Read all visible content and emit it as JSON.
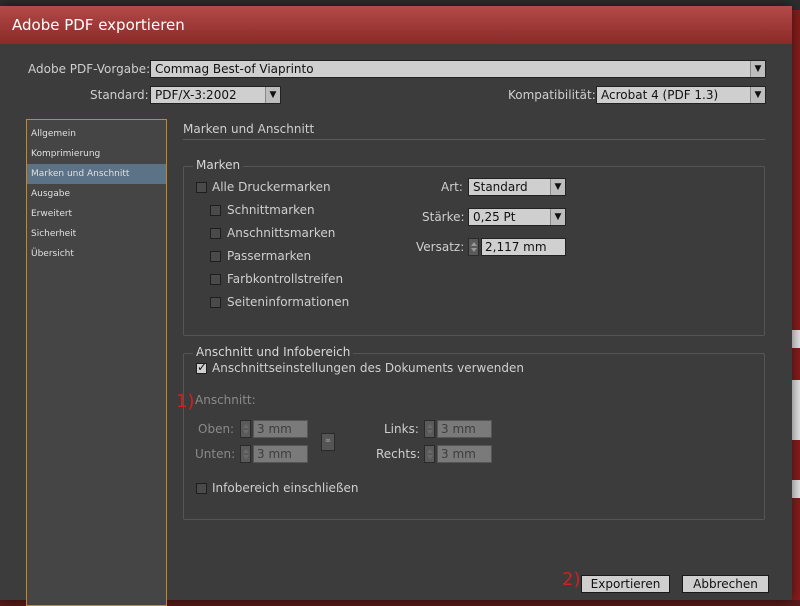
{
  "window": {
    "title": "Adobe PDF exportieren"
  },
  "header": {
    "preset_label": "Adobe PDF-Vorgabe:",
    "preset_value": "Commag Best-of Viaprinto",
    "standard_label": "Standard:",
    "standard_value": "PDF/X-3:2002",
    "compat_label": "Kompatibilität:",
    "compat_value": "Acrobat 4 (PDF 1.3)"
  },
  "sidebar": {
    "items": [
      {
        "label": "Allgemein"
      },
      {
        "label": "Komprimierung"
      },
      {
        "label": "Marken und Anschnitt"
      },
      {
        "label": "Ausgabe"
      },
      {
        "label": "Erweitert"
      },
      {
        "label": "Sicherheit"
      },
      {
        "label": "Übersicht"
      }
    ],
    "active_index": 2
  },
  "main": {
    "section_title": "Marken und Anschnitt",
    "marks": {
      "group_title": "Marken",
      "all_marks": {
        "label": "Alle Druckermarken",
        "checked": false
      },
      "options": [
        {
          "label": "Schnittmarken",
          "checked": false
        },
        {
          "label": "Anschnittsmarken",
          "checked": false
        },
        {
          "label": "Passermarken",
          "checked": false
        },
        {
          "label": "Farbkontrollstreifen",
          "checked": false
        },
        {
          "label": "Seiteninformationen",
          "checked": false
        }
      ],
      "type_label": "Art:",
      "type_value": "Standard",
      "weight_label": "Stärke:",
      "weight_value": "0,25 Pt",
      "offset_label": "Versatz:",
      "offset_value": "2,117 mm"
    },
    "bleed": {
      "group_title": "Anschnitt und Infobereich",
      "use_doc": {
        "label": "Anschnittseinstellungen des Dokuments verwenden",
        "checked": true
      },
      "bleed_label": "Anschnitt:",
      "top_label": "Oben:",
      "top_value": "3 mm",
      "bottom_label": "Unten:",
      "bottom_value": "3 mm",
      "left_label": "Links:",
      "left_value": "3 mm",
      "right_label": "Rechts:",
      "right_value": "3 mm",
      "slug": {
        "label": "Infobereich einschließen",
        "checked": false
      }
    }
  },
  "annotations": {
    "one": "1)",
    "two": "2)"
  },
  "footer": {
    "export_label": "Exportieren",
    "cancel_label": "Abbrechen"
  },
  "colors": {
    "accent": "#c8891a",
    "titlebar": "#a03c3a",
    "sidebar_active": "#5b7287",
    "annotation": "#d02020"
  }
}
